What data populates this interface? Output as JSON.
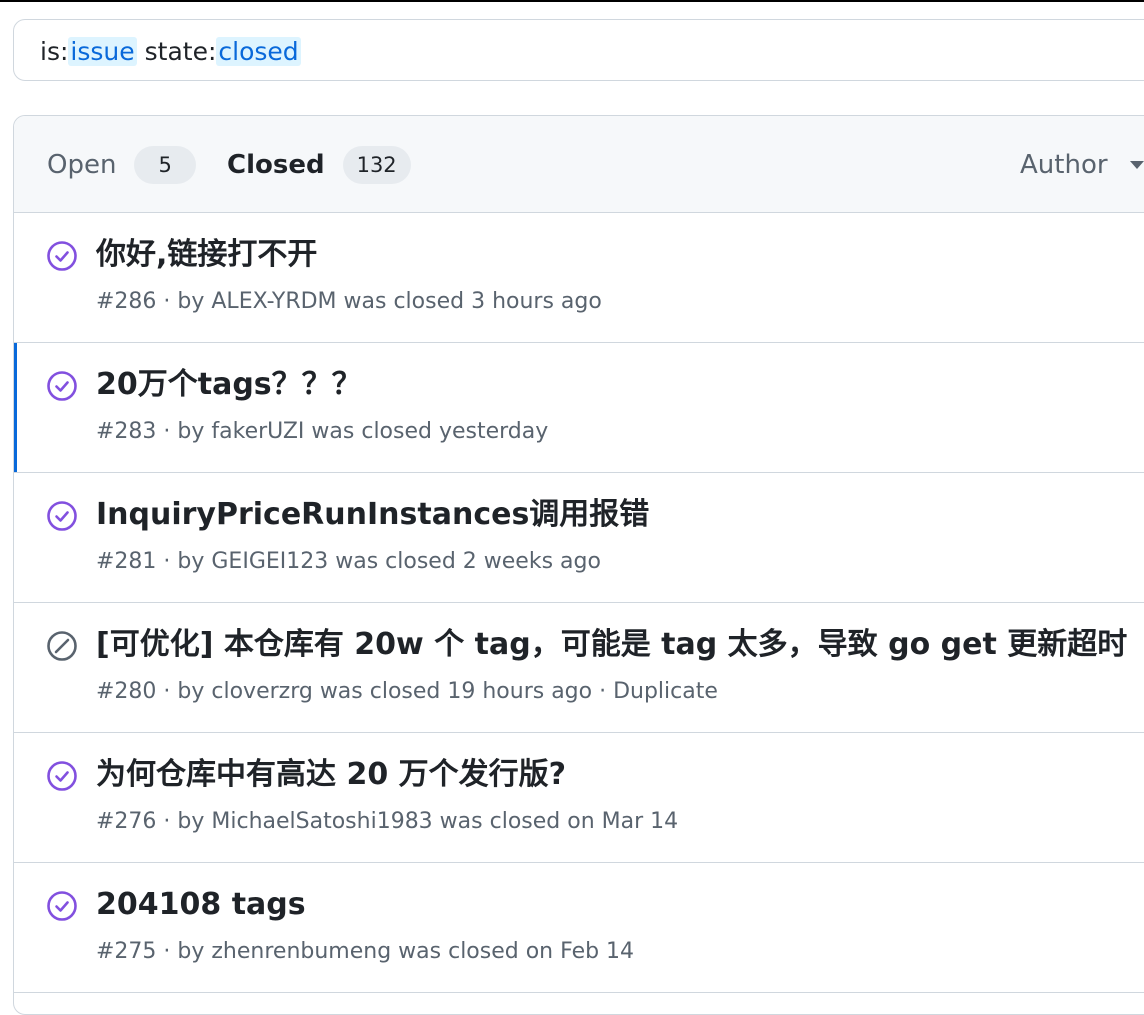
{
  "search": {
    "prefix_label": "is:",
    "value_1": "issue",
    "middle_label": "state:",
    "value_2": "closed"
  },
  "tabs": {
    "open_label": "Open",
    "open_count": "5",
    "closed_label": "Closed",
    "closed_count": "132"
  },
  "filters": {
    "author_label": "Author"
  },
  "colors": {
    "closed_purple": "#8250df",
    "not_planned_gray": "#59636e",
    "accent_blue": "#0969da"
  },
  "issues": [
    {
      "title": "你好,链接打不开",
      "meta": "#286 · by ALEX-YRDM was closed 3 hours ago",
      "icon": "check-circle-icon"
    },
    {
      "title": "20万个tags？？？",
      "meta": "#283 · by fakerUZI was closed yesterday",
      "icon": "check-circle-icon"
    },
    {
      "title": "InquiryPriceRunInstances调用报错",
      "meta": "#281 · by GEIGEI123 was closed 2 weeks ago",
      "icon": "check-circle-icon"
    },
    {
      "title": "[可优化] 本仓库有 20w 个 tag，可能是 tag 太多，导致 go get 更新超时",
      "meta": "#280 · by cloverzrg was closed 19 hours ago · Duplicate",
      "icon": "skip-circle-icon"
    },
    {
      "title": "为何仓库中有高达 20 万个发行版?",
      "meta": "#276 · by MichaelSatoshi1983 was closed on Mar 14",
      "icon": "check-circle-icon"
    },
    {
      "title": "204108 tags",
      "meta": "#275 · by zhenrenbumeng was closed on Feb 14",
      "icon": "check-circle-icon"
    }
  ]
}
